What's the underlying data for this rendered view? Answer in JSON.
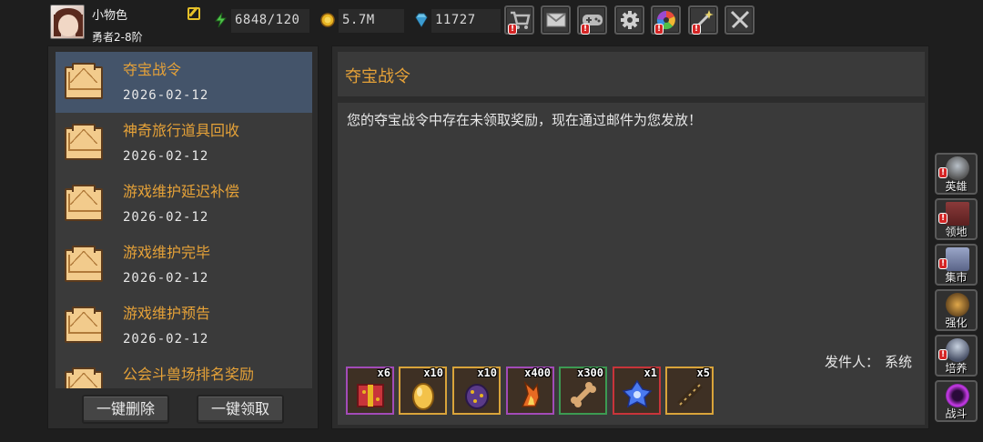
{
  "player": {
    "name": "小物色",
    "rank": "勇者2-8阶",
    "avatar_icon": "hero-portrait-icon"
  },
  "resources": {
    "energy": "6848/120",
    "gold": "5.7M",
    "gems": "11727"
  },
  "top_buttons": [
    {
      "icon": "shop-cart-icon",
      "alert": true
    },
    {
      "icon": "mail-icon",
      "alert": false
    },
    {
      "icon": "gamepad-icon",
      "alert": true
    },
    {
      "icon": "settings-gear-icon",
      "alert": false
    },
    {
      "icon": "color-wheel-icon",
      "alert": true
    },
    {
      "icon": "sparkle-wand-icon",
      "alert": true
    },
    {
      "icon": "crossed-swords-icon",
      "alert": false
    }
  ],
  "mail_list": [
    {
      "title": "夺宝战令",
      "date": "2026-02-12",
      "selected": true
    },
    {
      "title": "神奇旅行道具回收",
      "date": "2026-02-12",
      "selected": false
    },
    {
      "title": "游戏维护延迟补偿",
      "date": "2026-02-12",
      "selected": false
    },
    {
      "title": "游戏维护完毕",
      "date": "2026-02-12",
      "selected": false
    },
    {
      "title": "游戏维护预告",
      "date": "2026-02-12",
      "selected": false
    },
    {
      "title": "公会斗兽场排名奖励",
      "date": "",
      "selected": false
    }
  ],
  "actions": {
    "delete_all": "一键删除",
    "claim_all": "一键领取"
  },
  "detail": {
    "title": "夺宝战令",
    "body": "您的夺宝战令中存在未领取奖励，现在通过邮件为您发放！",
    "sender_label": "发件人：",
    "sender_name": "系统"
  },
  "rewards": [
    {
      "qty": "x6",
      "border": "#a24bb8",
      "icon": "red-gift-pack-icon"
    },
    {
      "qty": "x10",
      "border": "#d9a43a",
      "icon": "golden-egg-icon"
    },
    {
      "qty": "x10",
      "border": "#d9a43a",
      "icon": "purple-dice-egg-icon"
    },
    {
      "qty": "x400",
      "border": "#a24bb8",
      "icon": "flame-shard-icon"
    },
    {
      "qty": "x300",
      "border": "#3c9a52",
      "icon": "bone-icon"
    },
    {
      "qty": "x1",
      "border": "#c8343a",
      "icon": "blue-crystal-icon"
    },
    {
      "qty": "x5",
      "border": "#d9a43a",
      "icon": "telescope-scroll-icon"
    }
  ],
  "side_nav": [
    {
      "label": "英雄",
      "icon": "hero-helmet-icon",
      "alert": true
    },
    {
      "label": "领地",
      "icon": "castle-icon",
      "alert": true
    },
    {
      "label": "集市",
      "icon": "market-stall-icon",
      "alert": true
    },
    {
      "label": "强化",
      "icon": "enhance-rune-icon",
      "alert": false
    },
    {
      "label": "培养",
      "icon": "trophy-cultivate-icon",
      "alert": true
    },
    {
      "label": "战斗",
      "icon": "battle-portal-icon",
      "alert": false
    }
  ],
  "colors": {
    "accent_orange": "#e6a238",
    "selected_row": "#44546a",
    "panel_bg": "#3a3a3a",
    "alert_red": "#d42525"
  }
}
